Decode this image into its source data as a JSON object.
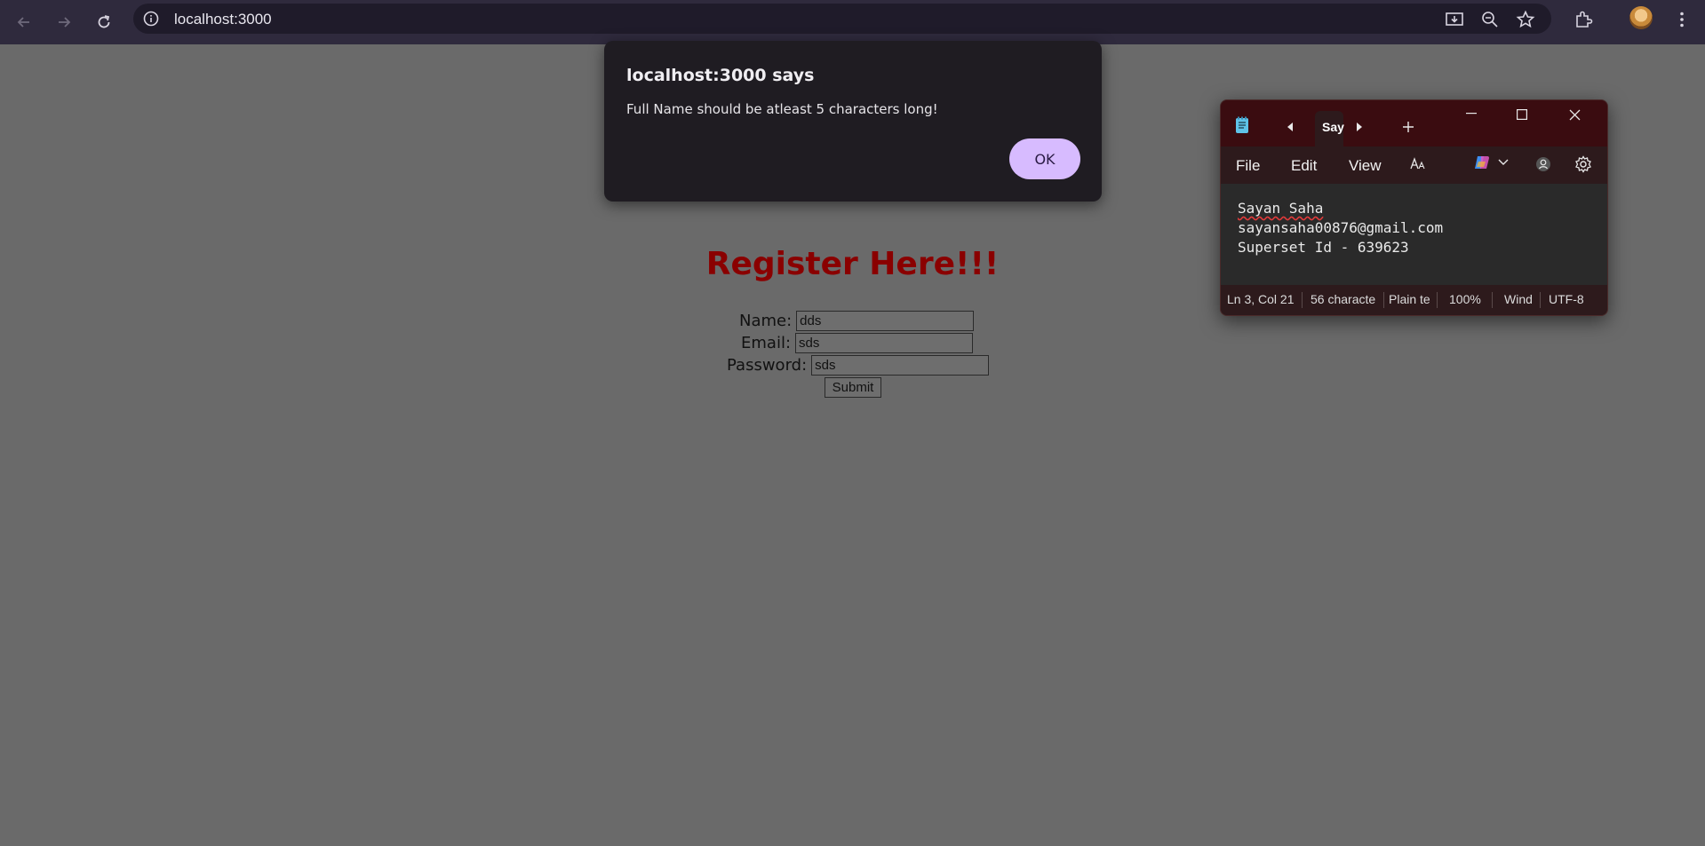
{
  "browser": {
    "url": "localhost:3000",
    "icons": [
      "back-icon",
      "forward-icon",
      "reload-icon",
      "site-info-icon",
      "install-app-icon",
      "zoom-icon",
      "bookmark-star-icon",
      "extensions-icon",
      "profile-avatar",
      "menu-kebab-icon"
    ]
  },
  "alert": {
    "title": "localhost:3000 says",
    "message": "Full Name should be atleast 5 characters long!",
    "ok_label": "OK"
  },
  "page": {
    "heading": "Register Here!!!",
    "heading_color": "#8a0000",
    "form": {
      "name_label": "Name:",
      "name_value": "dds",
      "email_label": "Email:",
      "email_value": "sds",
      "password_label": "Password:",
      "password_value": "sds",
      "submit_label": "Submit"
    }
  },
  "notepad": {
    "tab_label": "Say",
    "menu": [
      "File",
      "Edit",
      "View"
    ],
    "lines": [
      "Sayan Saha",
      "sayansaha00876@gmail.com",
      "Superset Id - 639623"
    ],
    "status": {
      "position": "Ln 3, Col 21",
      "characters": "56 characte",
      "format": "Plain te",
      "zoom": "100%",
      "line_ending": "Wind",
      "encoding": "UTF-8"
    }
  }
}
